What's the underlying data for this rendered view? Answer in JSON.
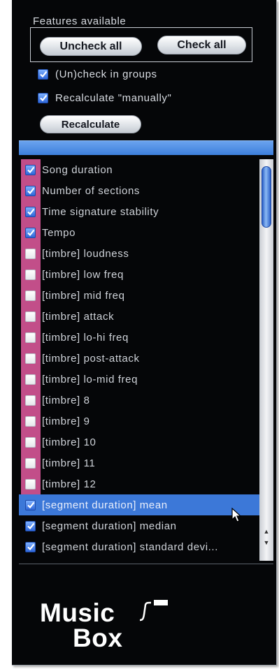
{
  "features": {
    "title": "Features available",
    "uncheck_all_label": "Uncheck all",
    "check_all_label": "Check all",
    "options": [
      {
        "label": "(Un)check in groups",
        "checked": true
      },
      {
        "label": "Recalculate \"manually\"",
        "checked": true
      }
    ],
    "recalculate_label": "Recalculate"
  },
  "list": {
    "items": [
      {
        "label": "Song duration",
        "checked": true,
        "group": "pink"
      },
      {
        "label": "Number of sections",
        "checked": true,
        "group": "pink"
      },
      {
        "label": "Time signature stability",
        "checked": true,
        "group": "pink"
      },
      {
        "label": "Tempo",
        "checked": true,
        "group": "pink"
      },
      {
        "label": "[timbre] loudness",
        "checked": false,
        "group": "pink"
      },
      {
        "label": "[timbre] low freq",
        "checked": false,
        "group": "pink"
      },
      {
        "label": "[timbre] mid freq",
        "checked": false,
        "group": "pink"
      },
      {
        "label": "[timbre] attack",
        "checked": false,
        "group": "pink"
      },
      {
        "label": "[timbre] lo-hi freq",
        "checked": false,
        "group": "pink"
      },
      {
        "label": "[timbre] post-attack",
        "checked": false,
        "group": "pink"
      },
      {
        "label": "[timbre] lo-mid freq",
        "checked": false,
        "group": "pink"
      },
      {
        "label": "[timbre] 8",
        "checked": false,
        "group": "pink"
      },
      {
        "label": "[timbre] 9",
        "checked": false,
        "group": "pink"
      },
      {
        "label": "[timbre] 10",
        "checked": false,
        "group": "pink"
      },
      {
        "label": "[timbre] 11",
        "checked": false,
        "group": "pink"
      },
      {
        "label": "[timbre] 12",
        "checked": false,
        "group": "pink"
      },
      {
        "label": "[segment duration] mean",
        "checked": true,
        "group": "none",
        "selected": true
      },
      {
        "label": "[segment duration] median",
        "checked": true,
        "group": "none"
      },
      {
        "label": "[segment duration] standard devi...",
        "checked": true,
        "group": "none"
      }
    ],
    "scroll_position": 0.02
  },
  "logo": {
    "line1": "Music",
    "line2": "Box"
  },
  "colors": {
    "panel_bg": "#050608",
    "accent_blue": "#3c78d8",
    "group_pink": "#c24e89",
    "text": "#d8dce2"
  }
}
